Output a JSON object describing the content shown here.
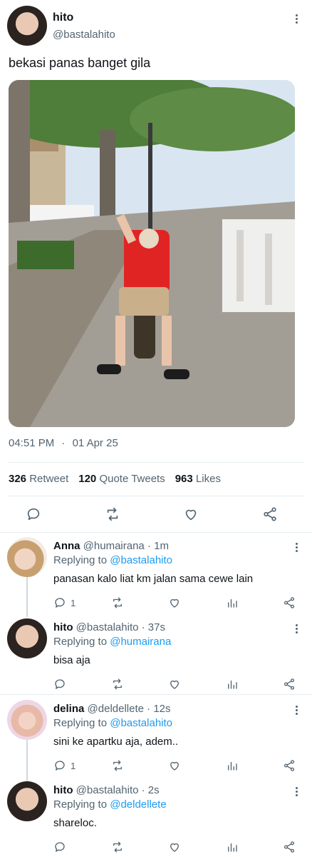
{
  "tweet": {
    "author_name": "hito",
    "author_handle": "@bastalahito",
    "text": "bekasi panas banget gila",
    "time": "04:51 PM",
    "date": "01 Apr 25",
    "separator": "·",
    "stats": {
      "retweets_count": "326",
      "retweets_label": "Retweet",
      "quotes_count": "120",
      "quotes_label": "Quote Tweets",
      "likes_count": "963",
      "likes_label": "Likes"
    }
  },
  "replies": [
    {
      "name": "Anna",
      "handle": "@humairana",
      "age": "· 1m",
      "replying_prefix": "Replying to",
      "replying_to": "@bastalahito",
      "text": "panasan kalo liat km jalan sama cewe lain",
      "reply_count": "1"
    },
    {
      "name": "hito",
      "handle": "@bastalahito",
      "age": "· 37s",
      "replying_prefix": "Replying to",
      "replying_to": "@humairana",
      "text": "bisa aja",
      "reply_count": ""
    },
    {
      "name": "delina",
      "handle": "@deldellete",
      "age": "· 12s",
      "replying_prefix": "Replying to",
      "replying_to": "@bastalahito",
      "text": "sini ke apartku aja, adem..",
      "reply_count": "1"
    },
    {
      "name": "hito",
      "handle": "@bastalahito",
      "age": "· 2s",
      "replying_prefix": "Replying to",
      "replying_to": "@deldellete",
      "text": "shareloc.",
      "reply_count": ""
    }
  ],
  "icons": {
    "more": "more-icon",
    "reply": "reply-icon",
    "retweet": "retweet-icon",
    "like": "heart-icon",
    "share": "share-icon",
    "analytics": "analytics-icon"
  },
  "colors": {
    "link": "#1d9bf0",
    "secondary_text": "#536471",
    "primary_text": "#0f1419"
  }
}
